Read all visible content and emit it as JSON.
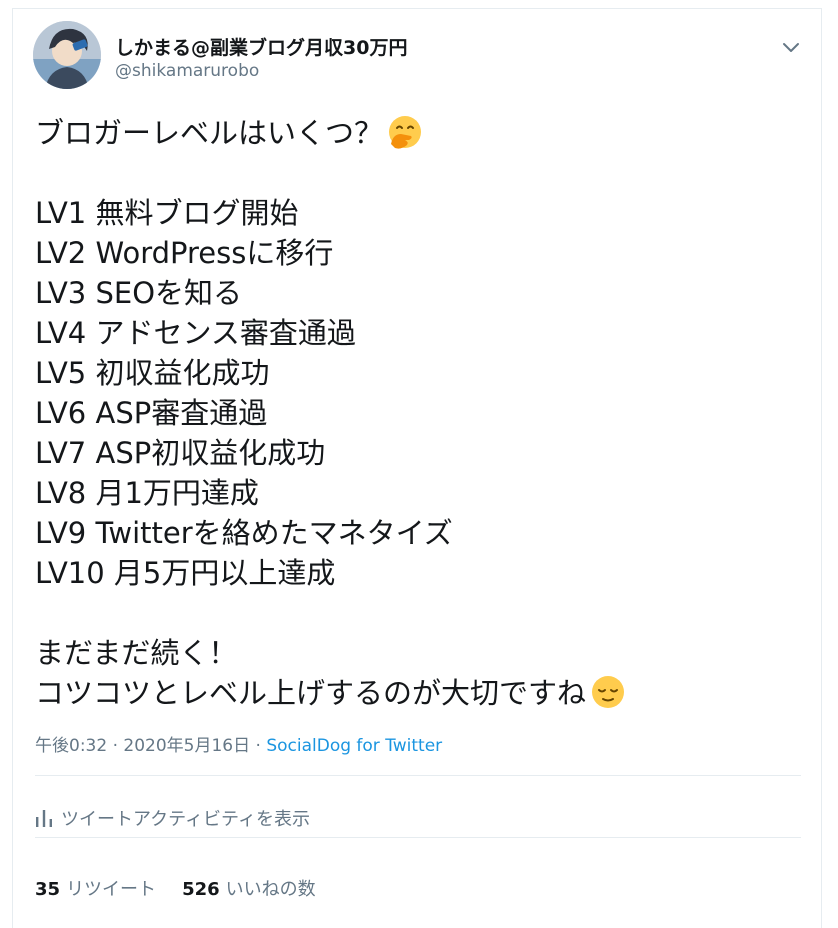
{
  "author": {
    "display_name": "しかまる@副業ブログ月収30万円",
    "handle": "@shikamarurobo"
  },
  "icons": {
    "more": "chevron-down-icon",
    "activity": "bar-chart-icon",
    "emoji_1": "hand-over-mouth-emoji",
    "emoji_2": "relieved-face-emoji"
  },
  "tweet": {
    "line_1": "ブロガーレベルはいくつ？",
    "line_3": "LV1 無料ブログ開始",
    "line_4": "LV2 WordPressに移行",
    "line_5": "LV3 SEOを知る",
    "line_6": "LV4 アドセンス審査通過",
    "line_7": "LV5 初収益化成功",
    "line_8": "LV6 ASP審査通過",
    "line_9": "LV7 ASP初収益化成功",
    "line_10": "LV8 月1万円達成",
    "line_11": "LV9 Twitterを絡めたマネタイズ",
    "line_12": "LV10 月5万円以上達成",
    "line_14": "まだまだ続く！",
    "line_15": "コツコツとレベル上げするのが大切ですね"
  },
  "meta": {
    "timestamp": "午後0:32 · 2020年5月16日",
    "separator": " · ",
    "source": "SocialDog for Twitter"
  },
  "activity": {
    "label": "ツイートアクティビティを表示"
  },
  "stats": {
    "retweets_count": "35",
    "retweets_label": "リツイート",
    "likes_count": "526",
    "likes_label": "いいねの数"
  },
  "colors": {
    "text": "#14171a",
    "secondary": "#657786",
    "link": "#1b95e0",
    "border": "#e6ecf0",
    "emoji_yellow": "#ffcc4d"
  }
}
